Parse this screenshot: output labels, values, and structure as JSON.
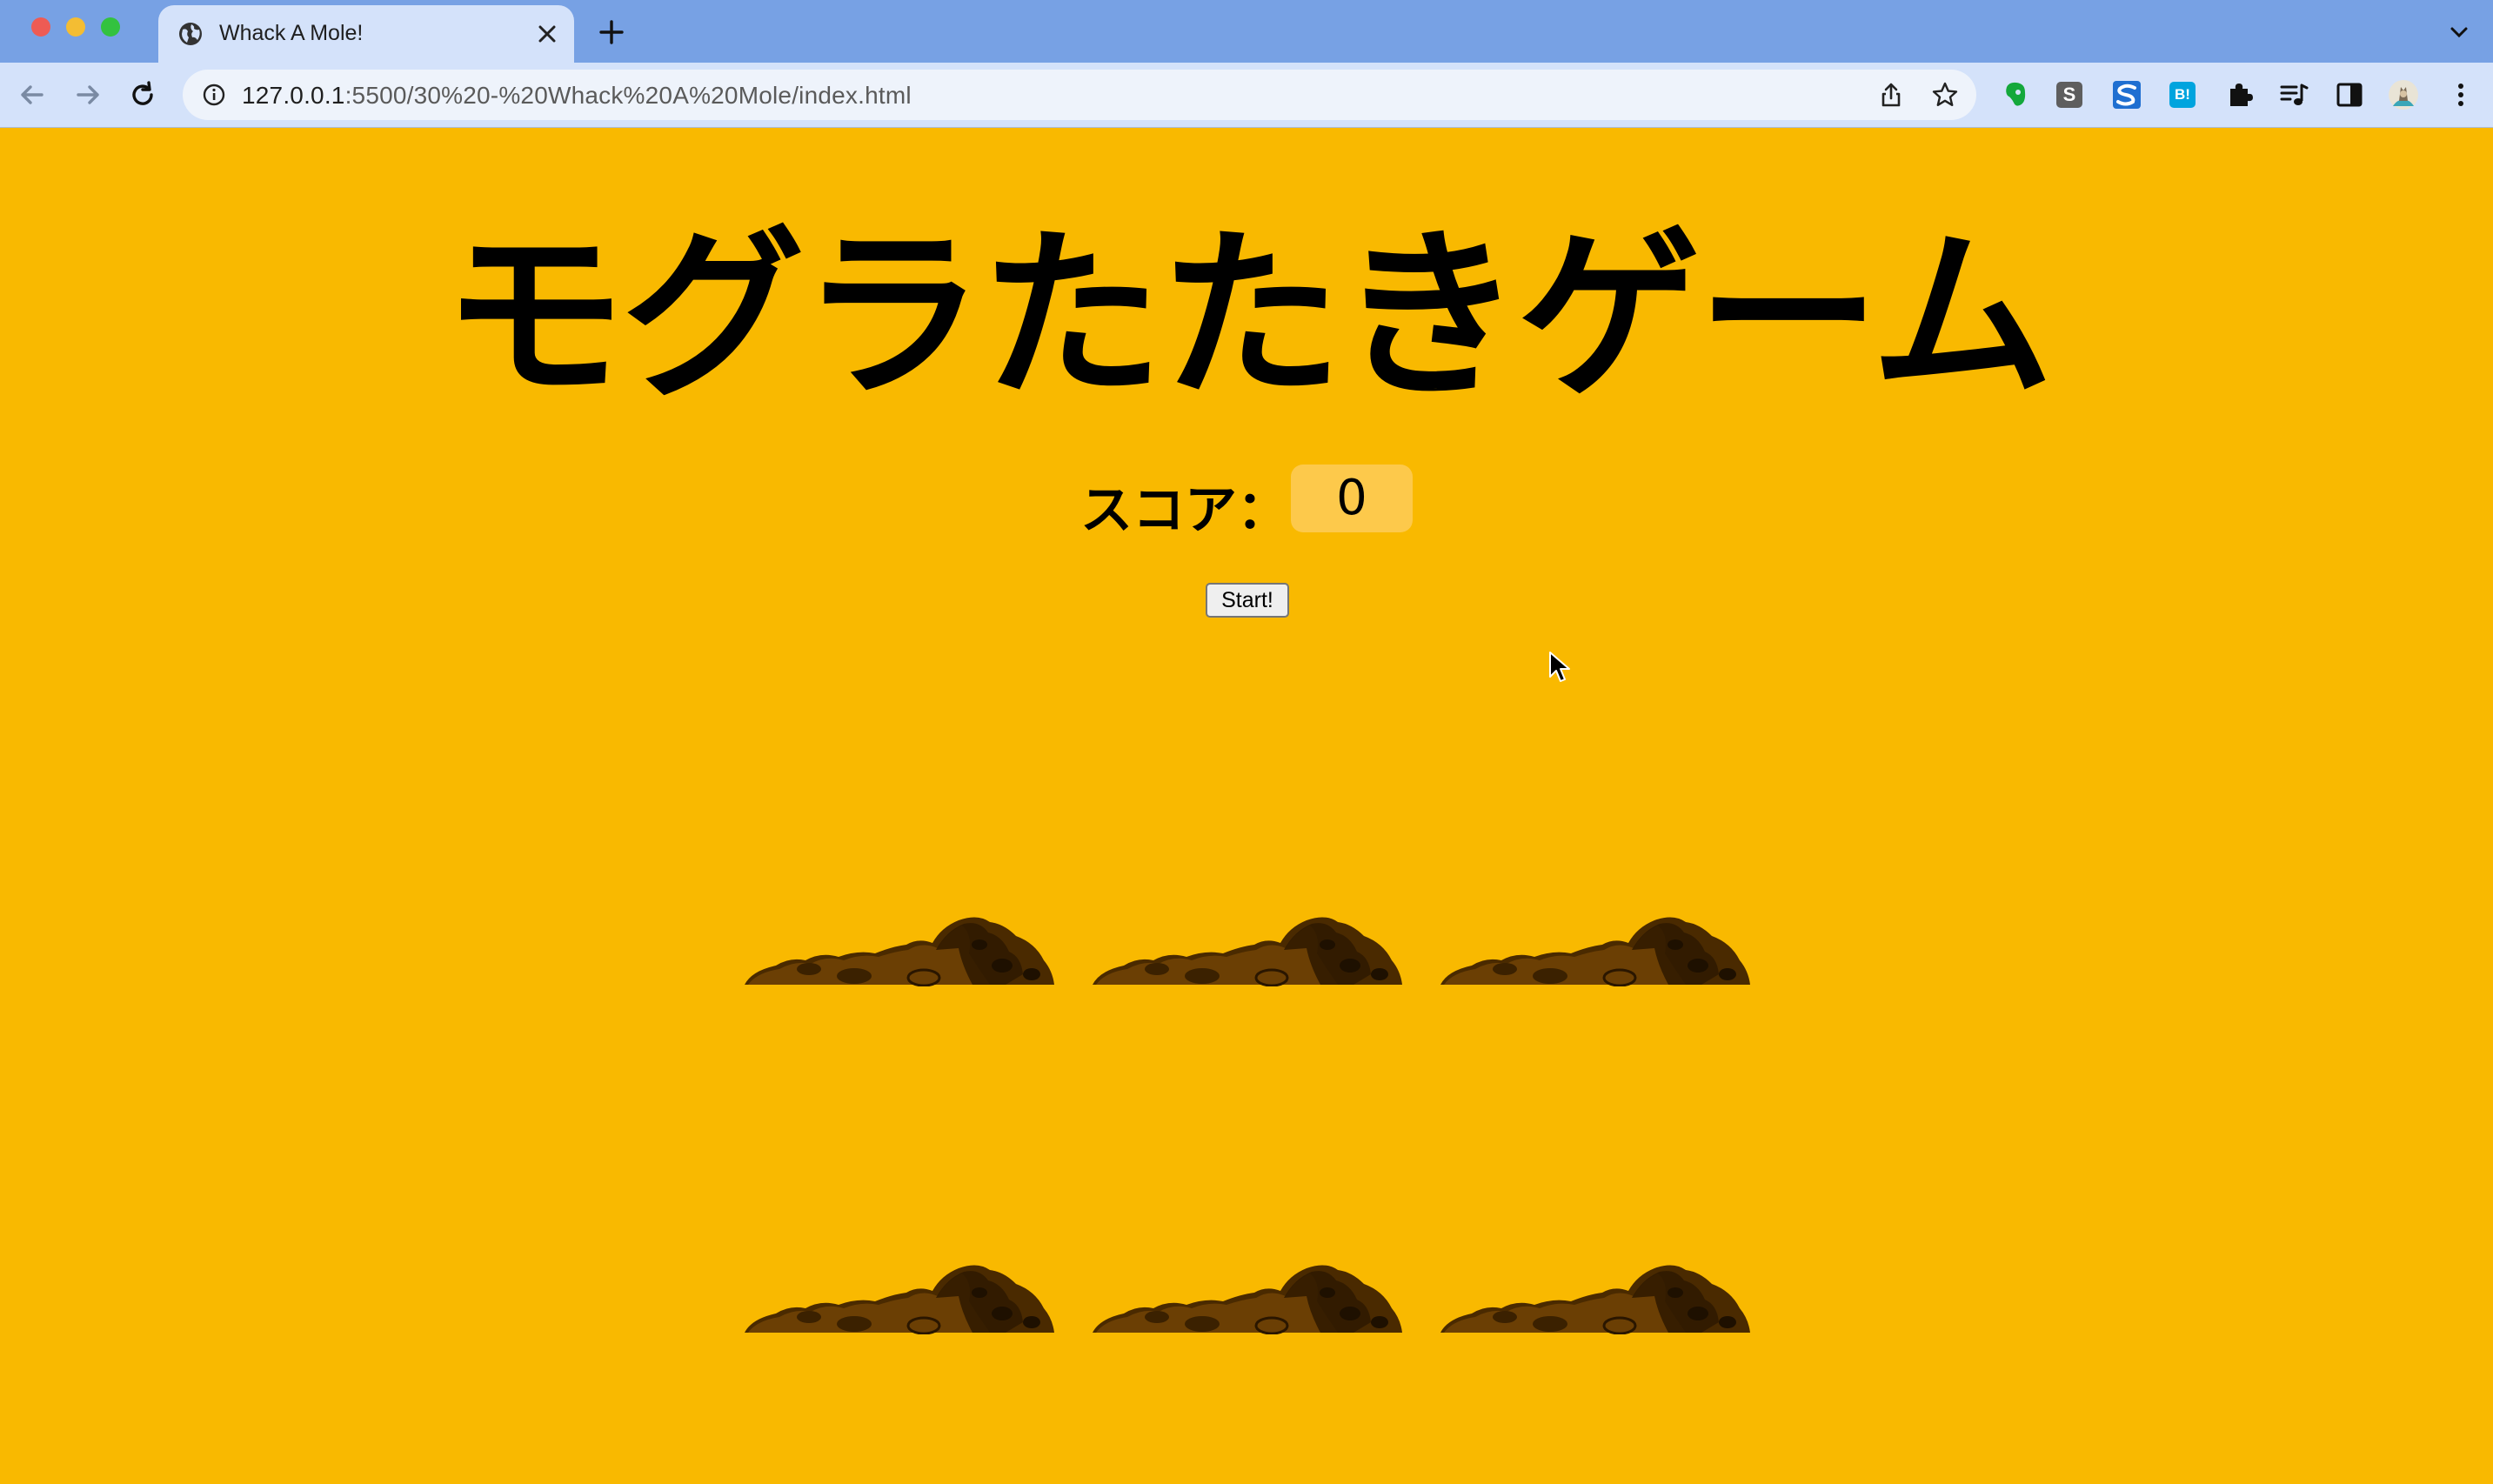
{
  "browser": {
    "tab_title": "Whack A Mole!",
    "url_host": "127.0.0.1",
    "url_rest": ":5500/30%20-%20Whack%20A%20Mole/index.html",
    "extensions": [
      "evernote-icon",
      "s-extension-icon",
      "scrapbox-icon",
      "hatena-bookmark-icon",
      "puzzle-icon",
      "media-icon",
      "sidepanel-icon",
      "profile-avatar",
      "menu-icon"
    ],
    "ext_labels": {
      "s": "S",
      "b": "B!"
    }
  },
  "game": {
    "title": "モグラたたきゲーム",
    "score_label": "スコア：",
    "score_value": "0",
    "start_label": "Start!",
    "holes": 6,
    "mole_visible": false
  },
  "colors": {
    "background": "#f9b900",
    "score_box": "#fdc94b",
    "dirt_dark": "#3d2200",
    "dirt_mid": "#6b3d00"
  }
}
